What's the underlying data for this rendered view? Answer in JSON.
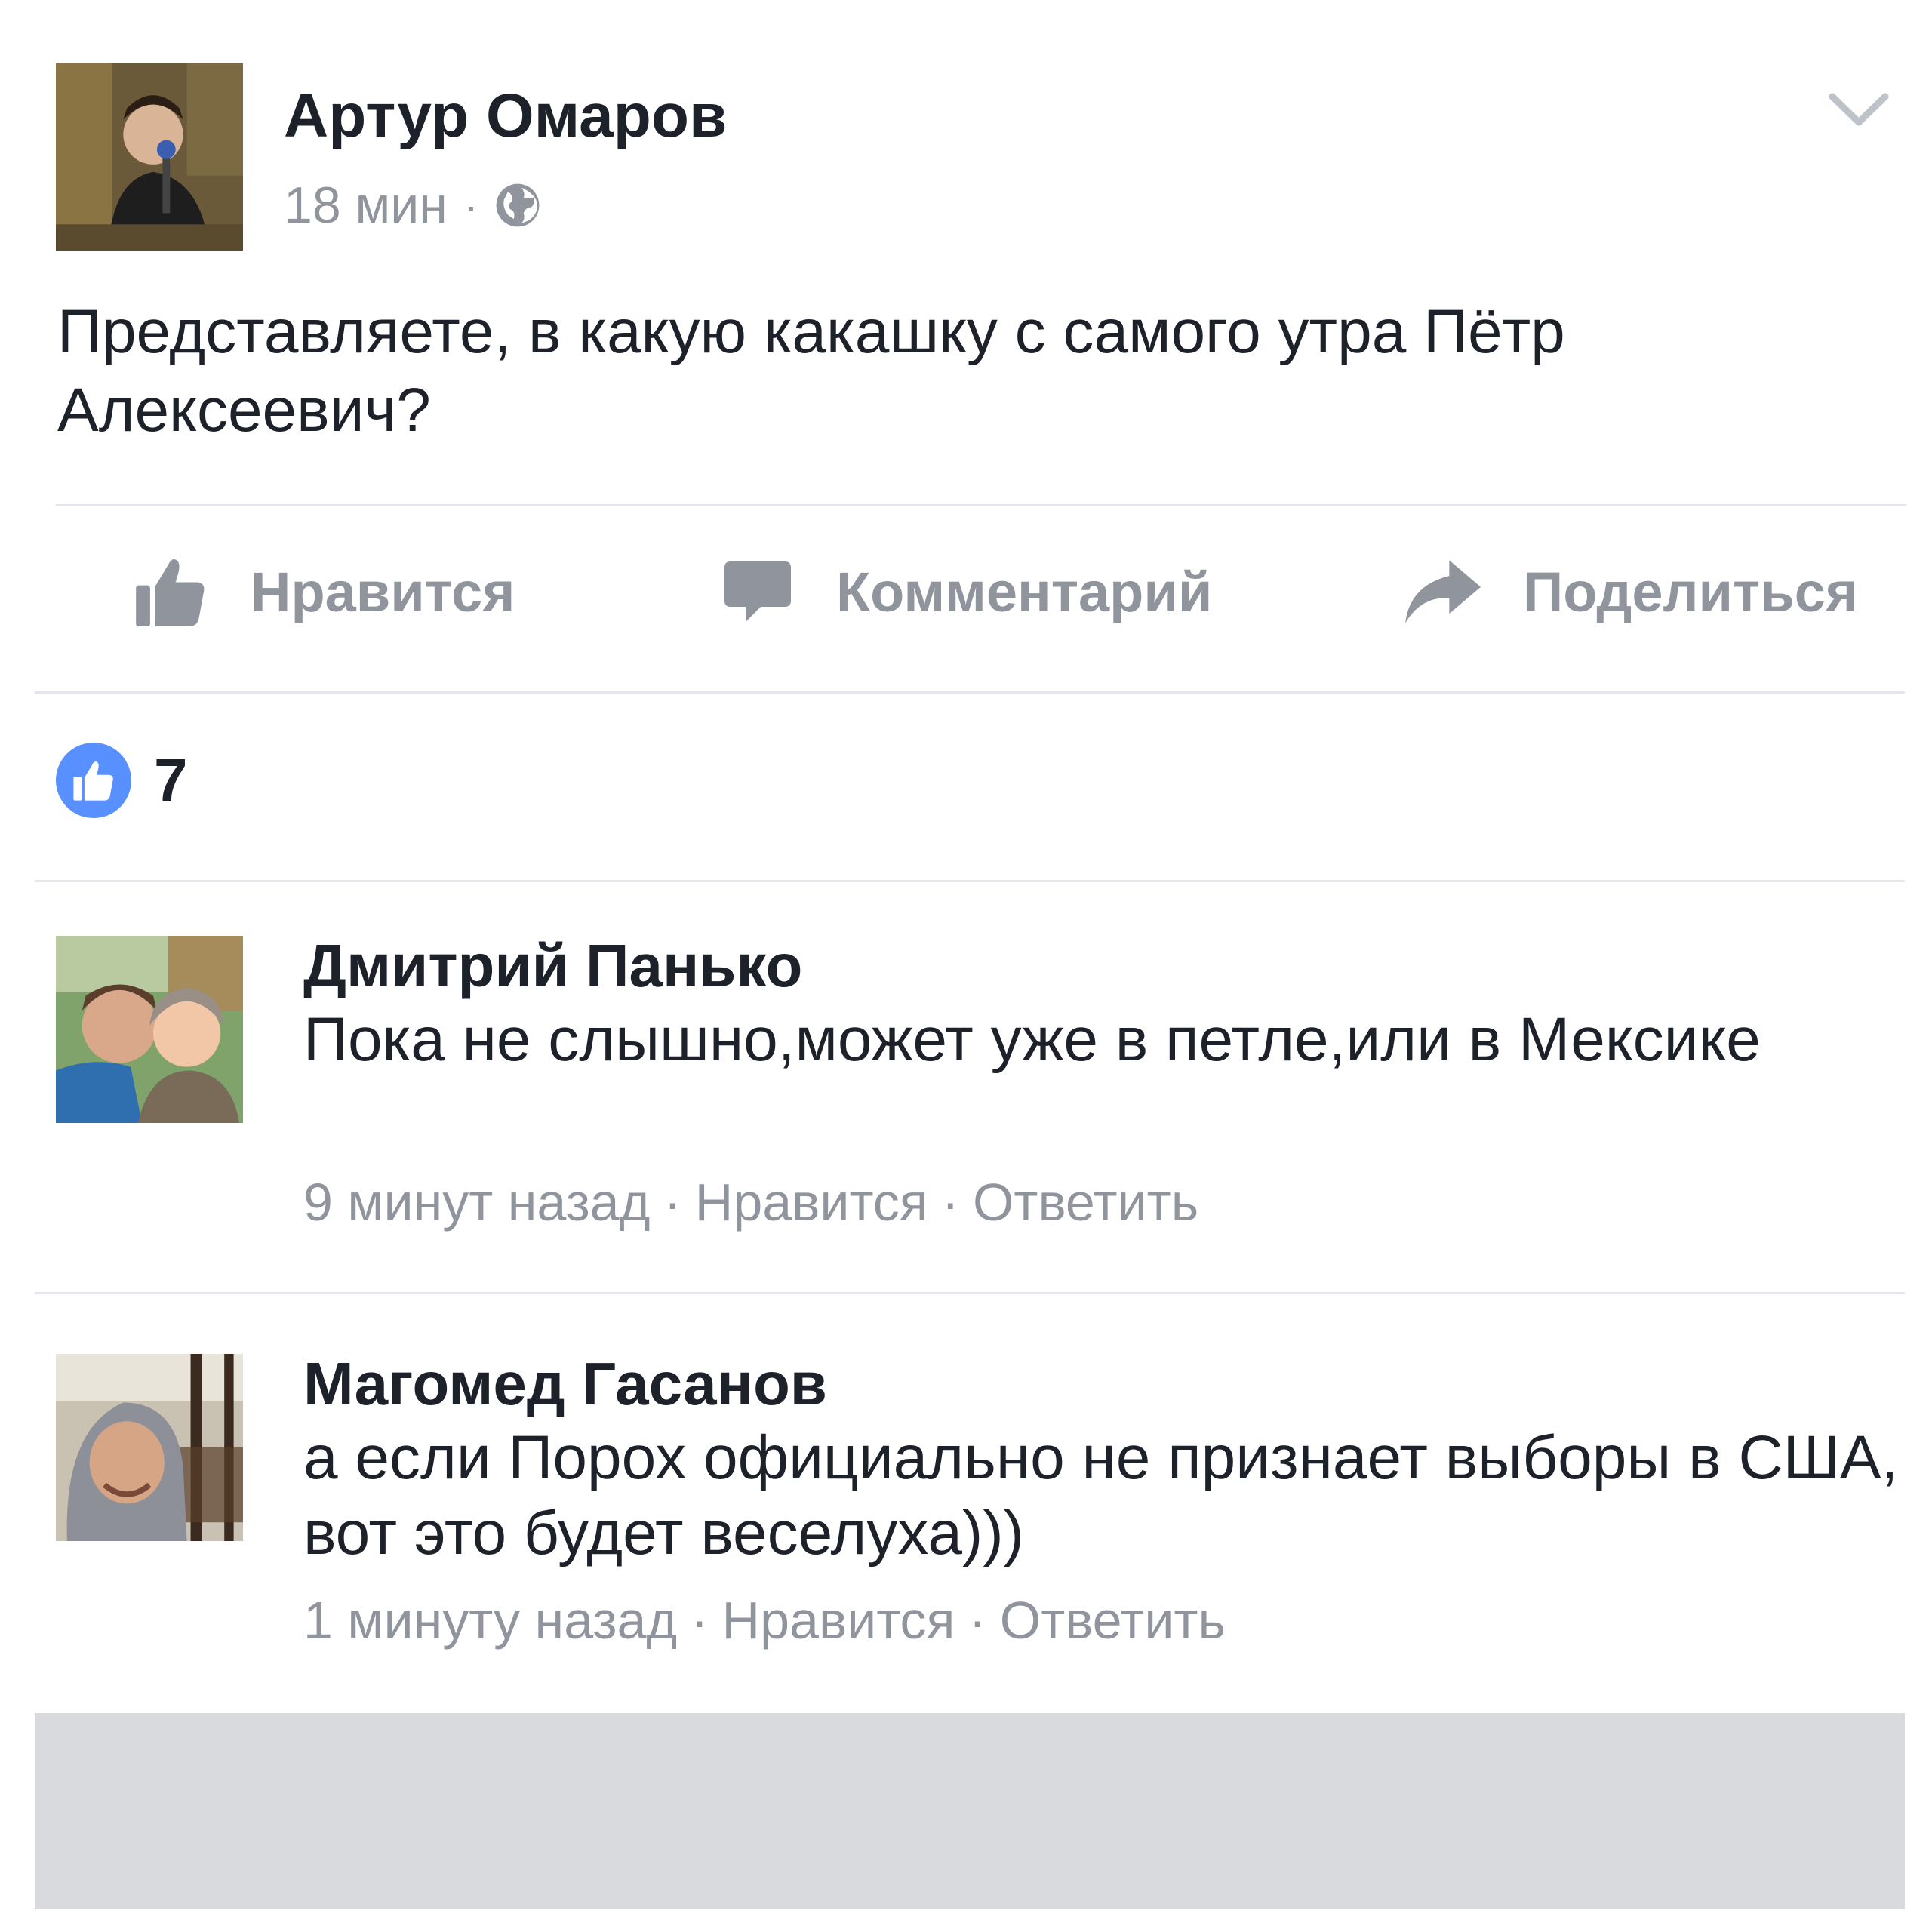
{
  "post": {
    "author": "Артур Омаров",
    "time": "18 мин",
    "separator": "·",
    "privacy_icon": "globe-icon",
    "text": "Представляете, в какую какашку с самого утра Пётр Алексеевич?"
  },
  "actions": {
    "like_label": "Нравится",
    "comment_label": "Комментарий",
    "share_label": "Поделиться"
  },
  "reactions": {
    "icon": "like-icon",
    "count": "7",
    "accent_color": "#5890ff"
  },
  "comments": [
    {
      "author": "Дмитрий Панько",
      "text": "Пока не слышно,может уже в петле,или в Мексике",
      "time": "9 минут назад",
      "like_label": "Нравится",
      "reply_label": "Ответить",
      "separator": "·"
    },
    {
      "author": "Магомед Гасанов",
      "text": "а если Порох официально не признает выборы в США, вот это будет веселуха)))",
      "time": "1 минуту назад",
      "like_label": "Нравится",
      "reply_label": "Ответить",
      "separator": "·"
    }
  ],
  "colors": {
    "text": "#1d2129",
    "muted": "#90949c",
    "divider": "#e4e6eb",
    "like_blue": "#5890ff"
  }
}
